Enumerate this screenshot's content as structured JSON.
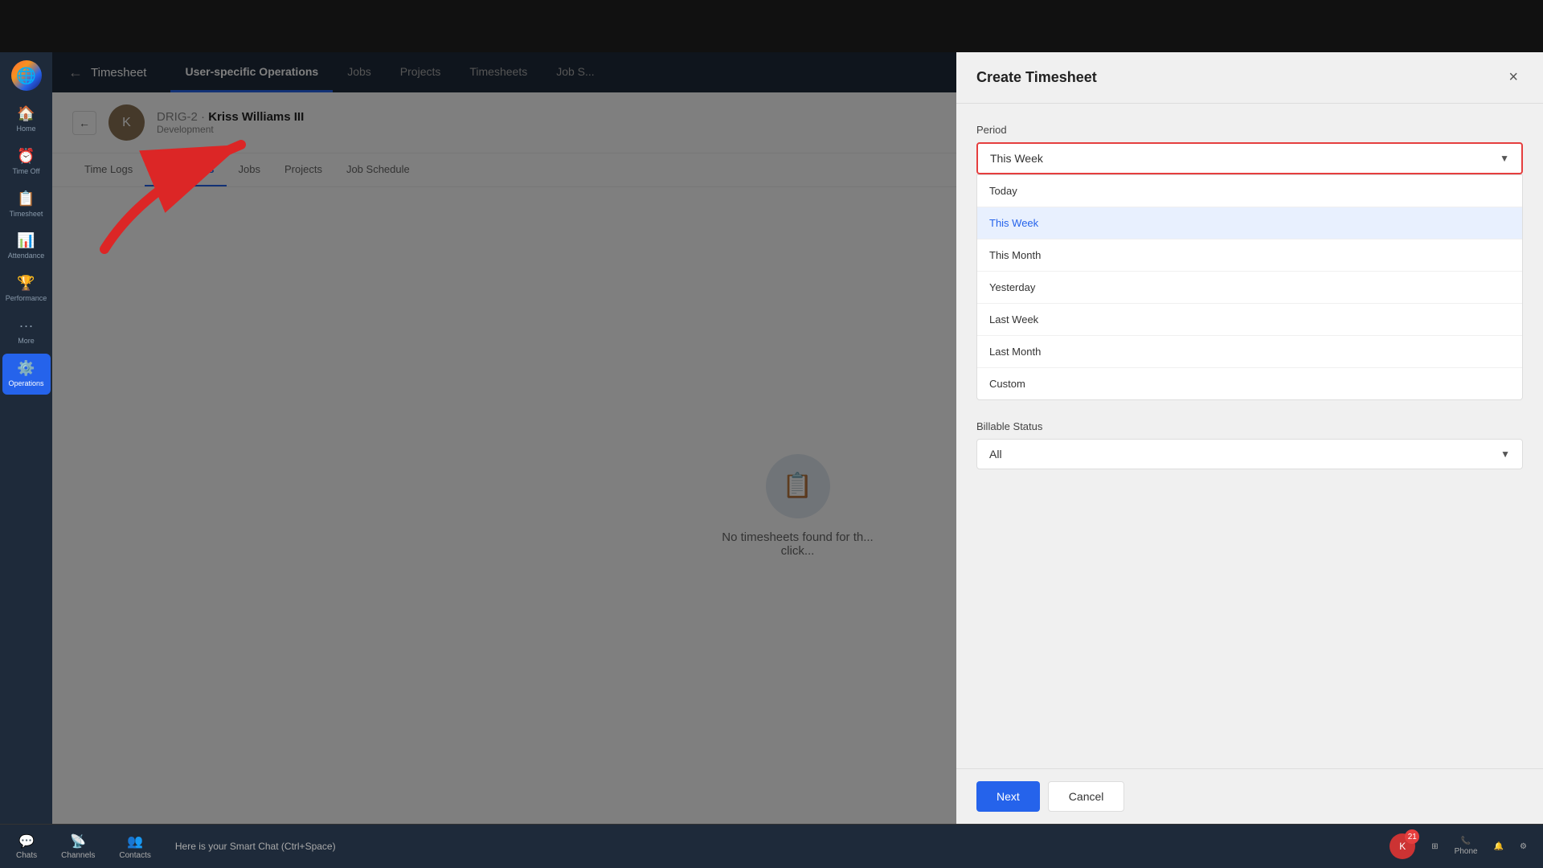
{
  "topBar": {
    "title": "Timesheet"
  },
  "sidebar": {
    "items": [
      {
        "id": "home",
        "label": "Home",
        "icon": "🏠"
      },
      {
        "id": "timeoff",
        "label": "Time Off",
        "icon": "⏰"
      },
      {
        "id": "timesheet",
        "label": "Timesheet",
        "icon": "📋"
      },
      {
        "id": "attendance",
        "label": "Attendance",
        "icon": "📊"
      },
      {
        "id": "performance",
        "label": "Performance",
        "icon": "🏆"
      },
      {
        "id": "more",
        "label": "More",
        "icon": "···"
      },
      {
        "id": "operations",
        "label": "Operations",
        "icon": "⚙️"
      }
    ]
  },
  "topNav": {
    "back": "←",
    "title": "Timesheet",
    "tabs": [
      {
        "id": "user-ops",
        "label": "User-specific Operations",
        "active": true
      },
      {
        "id": "jobs",
        "label": "Jobs"
      },
      {
        "id": "projects",
        "label": "Projects"
      },
      {
        "id": "timesheets",
        "label": "Timesheets"
      },
      {
        "id": "job-schedule",
        "label": "Job S..."
      }
    ]
  },
  "userHeader": {
    "userId": "DRIG-2",
    "userName": "Kriss Williams III",
    "department": "Development",
    "avatarInitial": "K"
  },
  "subNav": {
    "tabs": [
      {
        "id": "timelogs",
        "label": "Time Logs"
      },
      {
        "id": "timesheets",
        "label": "Timesheets",
        "active": true
      },
      {
        "id": "jobs",
        "label": "Jobs"
      },
      {
        "id": "projects",
        "label": "Projects"
      },
      {
        "id": "jobschedule",
        "label": "Job Schedule"
      }
    ]
  },
  "emptyState": {
    "message": "No timesheets found for th...",
    "message2": "click..."
  },
  "modal": {
    "title": "Create Timesheet",
    "closeLabel": "×",
    "periodLabel": "Period",
    "selectedPeriod": "This Week",
    "periodOptions": [
      {
        "id": "today",
        "label": "Today"
      },
      {
        "id": "this-week",
        "label": "This Week",
        "selected": true
      },
      {
        "id": "this-month",
        "label": "This Month"
      },
      {
        "id": "yesterday",
        "label": "Yesterday"
      },
      {
        "id": "last-week",
        "label": "Last Week"
      },
      {
        "id": "last-month",
        "label": "Last Month"
      },
      {
        "id": "custom",
        "label": "Custom"
      }
    ],
    "billableLabel": "Billable Status",
    "billableValue": "All",
    "nextButton": "Next",
    "cancelButton": "Cancel"
  },
  "bottomBar": {
    "items": [
      {
        "id": "chats",
        "label": "Chats",
        "icon": "💬"
      },
      {
        "id": "channels",
        "label": "Channels",
        "icon": "📡"
      },
      {
        "id": "contacts",
        "label": "Contacts",
        "icon": "👥"
      }
    ],
    "smartChat": "Here is your Smart Chat (Ctrl+Space)",
    "rightItems": [
      {
        "id": "grid",
        "icon": "⊞"
      },
      {
        "id": "phone",
        "label": "Phone",
        "icon": "📞"
      },
      {
        "id": "notification",
        "icon": "🔔"
      },
      {
        "id": "settings",
        "icon": "⚙"
      }
    ],
    "notificationCount": "21"
  }
}
